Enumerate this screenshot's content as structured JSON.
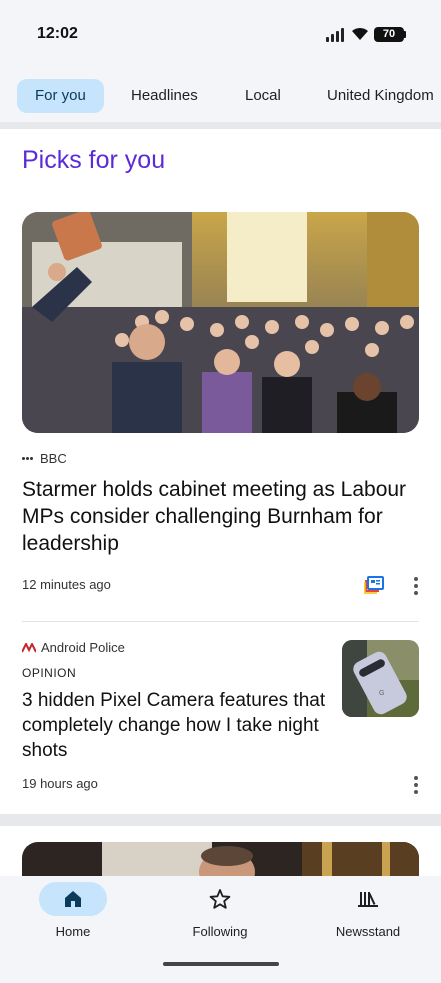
{
  "status_bar": {
    "time": "12:02",
    "battery": "70"
  },
  "tabs": [
    {
      "label": "For you",
      "active": true
    },
    {
      "label": "Headlines",
      "active": false
    },
    {
      "label": "Local",
      "active": false
    },
    {
      "label": "United Kingdom",
      "active": false
    }
  ],
  "section": {
    "title": "Picks for you"
  },
  "articles": [
    {
      "source": "BBC",
      "headline": "Starmer holds cabinet meeting as Labour MPs consider challenging Burnham for leadership",
      "time": "12 minutes ago"
    },
    {
      "source": "Android Police",
      "label": "OPINION",
      "headline": "3 hidden Pixel Camera features that completely change how I take night shots",
      "time": "19 hours ago"
    }
  ],
  "bottom_nav": [
    {
      "label": "Home",
      "icon": "home-icon",
      "active": true
    },
    {
      "label": "Following",
      "icon": "star-icon",
      "active": false
    },
    {
      "label": "Newsstand",
      "icon": "newsstand-icon",
      "active": false
    }
  ],
  "colors": {
    "accent": "#5b2bd6",
    "active_tab": "#c6e4fb",
    "background": "#f3f5f9"
  }
}
